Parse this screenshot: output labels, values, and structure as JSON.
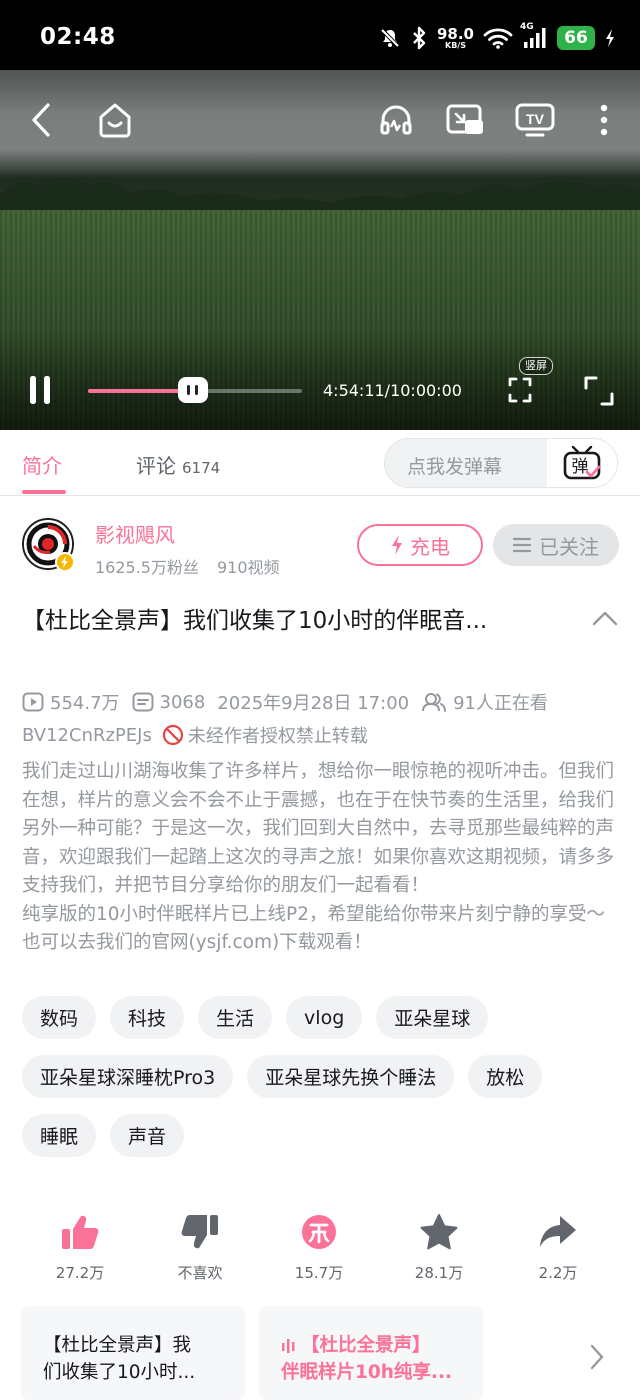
{
  "status_bar": {
    "time": "02:48",
    "net_speed": "98.0",
    "net_unit": "KB/S",
    "network_type": "4G",
    "battery": "66",
    "icons": [
      "mute-icon",
      "bluetooth-icon",
      "wifi-icon",
      "signal-icon",
      "charging-icon"
    ]
  },
  "player": {
    "current_time": "4:54:11",
    "total_time": "10:00:00",
    "time_display": "4:54:11/10:00:00",
    "progress_fraction": 0.49,
    "vertical_label": "竖屏",
    "accent": "#fb7299",
    "icons": [
      "back-icon",
      "home-icon",
      "audio-only-icon",
      "picture-in-picture-icon",
      "tv-cast-icon",
      "more-icon",
      "pause-icon",
      "vertical-screen-icon",
      "fullscreen-icon"
    ]
  },
  "tabs": {
    "intro_label": "简介",
    "comments_label": "评论",
    "comments_count": "6174",
    "danmaku_placeholder": "点我发弹幕",
    "danmaku_icon_label": "弹"
  },
  "uploader": {
    "name": "影视飓风",
    "fans": "1625.5万粉丝",
    "videos": "910视频",
    "charge_label": "充电",
    "follow_label": "已关注"
  },
  "video": {
    "title": "【杜比全景声】我们收集了10小时的伴眠音...",
    "views": "554.7万",
    "danmaku_count": "3068",
    "publish_time": "2025年9月28日 17:00",
    "watching": "91人正在看",
    "bvid": "BV12CnRzPEJs",
    "copyright": "未经作者授权禁止转载",
    "description": [
      "我们走过山川湖海收集了许多样片，想给你一眼惊艳的视听冲击。但我们在想，样片的意义会不会不止于震撼，也在于在快节奏的生活里，给我们另外一种可能？于是这一次，我们回到大自然中，去寻觅那些最纯粹的声音，欢迎跟我们一起踏上这次的寻声之旅！如果你喜欢这期视频，请多多支持我们，并把节目分享给你的朋友们一起看看！",
      "纯享版的10小时伴眠样片已上线P2，希望能给你带来片刻宁静的享受～也可以去我们的官网(ysjf.com)下载观看！"
    ]
  },
  "tags": [
    "数码",
    "科技",
    "生活",
    "vlog",
    "亚朵星球",
    "亚朵星球深睡枕Pro3",
    "亚朵星球先换个睡法",
    "放松",
    "睡眠",
    "声音"
  ],
  "actions": {
    "like": "27.2万",
    "dislike": "不喜欢",
    "coin": "15.7万",
    "favorite": "28.1万",
    "share": "2.2万"
  },
  "parts": [
    {
      "title_line1": "【杜比全景声】我",
      "title_line2": "们收集了10小时..."
    },
    {
      "title_line1": "【杜比全景声】",
      "title_line2": "伴眠样片10h纯享..."
    }
  ]
}
